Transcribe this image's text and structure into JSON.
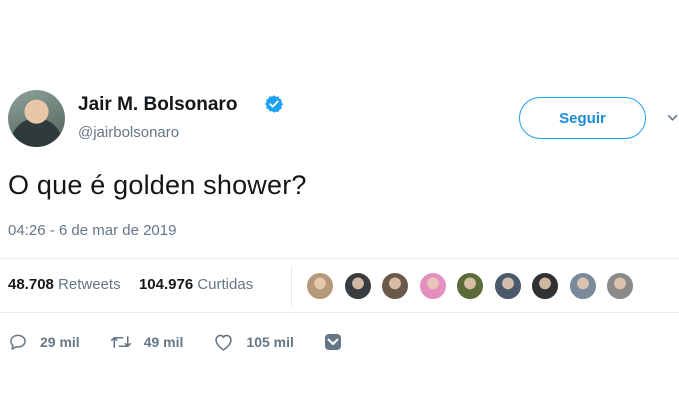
{
  "user": {
    "name": "Jair M. Bolsonaro",
    "handle": "@jairbolsonaro"
  },
  "follow_label": "Seguir",
  "tweet": {
    "text": "O que é golden shower?",
    "timestamp": "04:26 - 6 de mar de 2019"
  },
  "stats": {
    "retweets_count": "48.708",
    "retweets_label": "Retweets",
    "likes_count": "104.976",
    "likes_label": "Curtidas"
  },
  "likers": [
    {
      "color": "#b59a7a"
    },
    {
      "color": "#3a3d40"
    },
    {
      "color": "#6b5a4a"
    },
    {
      "color": "#e58fc0"
    },
    {
      "color": "#5b6b3a"
    },
    {
      "color": "#4a5a6a"
    },
    {
      "color": "#2f3133"
    },
    {
      "color": "#7a8a9a"
    },
    {
      "color": "#8a8a8a"
    }
  ],
  "actions": {
    "replies": "29 mil",
    "retweets": "49 mil",
    "likes": "105 mil"
  },
  "colors": {
    "accent": "#1da1f2",
    "text": "#14171a",
    "secondary": "#657786"
  }
}
